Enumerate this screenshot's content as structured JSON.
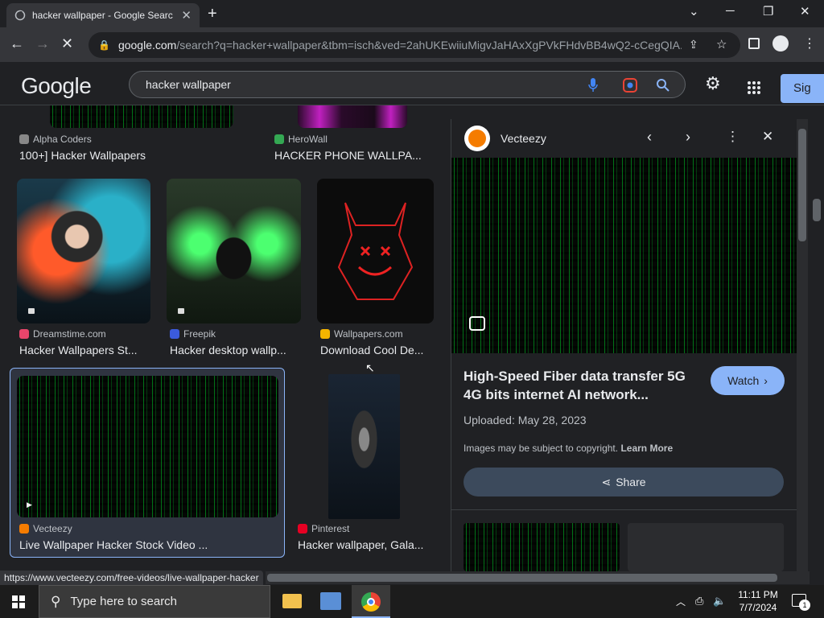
{
  "browser": {
    "tab_title": "hacker wallpaper - Google Searc",
    "url_domain": "google.com",
    "url_rest": "/search?q=hacker+wallpaper&tbm=isch&ved=2ahUKEwiiuMigvJaHAxXgPVkFHdvBB4wQ2-cCegQIA...",
    "status_url": "https://www.vecteezy.com/free-videos/live-wallpaper-hacker"
  },
  "google": {
    "logo": "Google",
    "query": "hacker wallpaper",
    "signin_label": "Sig"
  },
  "results": [
    {
      "source": "Alpha Coders",
      "title": "100+] Hacker Wallpapers",
      "icon_color": "#888888"
    },
    {
      "source": "HeroWall",
      "title": "HACKER PHONE WALLPA...",
      "icon_color": "#34a853"
    },
    {
      "source": "Dreamstime.com",
      "title": "Hacker Wallpapers St...",
      "icon_color": "#e8456b"
    },
    {
      "source": "Freepik",
      "title": "Hacker desktop wallp...",
      "icon_color": "#3b5bdb"
    },
    {
      "source": "Wallpapers.com",
      "title": "Download Cool De...",
      "icon_color": "#f4b400"
    },
    {
      "source": "Vecteezy",
      "title": "Live Wallpaper Hacker Stock Video ...",
      "icon_color": "#f57c00"
    },
    {
      "source": "Pinterest",
      "title": "Hacker wallpaper, Gala...",
      "icon_color": "#e60023"
    }
  ],
  "panel": {
    "site": "Vecteezy",
    "title": "High-Speed Fiber data transfer 5G 4G bits internet AI network...",
    "watch_label": "Watch",
    "uploaded": "Uploaded: May 28, 2023",
    "copyright": "Images may be subject to copyright.",
    "learn_more": "Learn More",
    "share_label": "Share"
  },
  "taskbar": {
    "search_placeholder": "Type here to search",
    "time": "11:11 PM",
    "date": "7/7/2024",
    "notif_count": "1"
  },
  "colors": {
    "accent": "#8ab4f8",
    "bg": "#202124"
  }
}
